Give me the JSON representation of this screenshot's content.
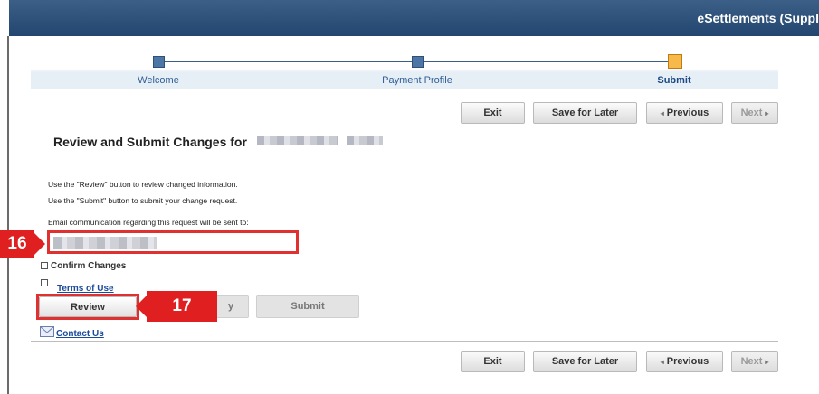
{
  "header": {
    "title": "eSettlements (Suppl"
  },
  "steps": [
    {
      "label": "Welcome",
      "active": false
    },
    {
      "label": "Payment Profile",
      "active": false
    },
    {
      "label": "Submit",
      "active": true
    }
  ],
  "nav": {
    "exit": "Exit",
    "save_for_later": "Save for Later",
    "previous": "Previous",
    "next": "Next"
  },
  "nav_glyphs": {
    "previous": "◂",
    "next": "▸"
  },
  "page": {
    "title": "Review and Submit Changes for",
    "line1": "Use the \"Review\" button to review changed information.",
    "line2": "Use the \"Submit\" button to submit your change request.",
    "email_label": "Email communication regarding this request will be sent to:",
    "email_value": ""
  },
  "checkboxes": {
    "confirm_changes": "Confirm Changes",
    "terms_of_use": "Terms of Use"
  },
  "actions": {
    "review": "Review",
    "partial": "y",
    "submit": "Submit"
  },
  "contact": {
    "label": "Contact Us"
  },
  "callouts": {
    "sixteen": "16",
    "seventeen": "17"
  },
  "colors": {
    "header": "#22466f",
    "callout": "#e02020",
    "link": "#1a4a9a"
  }
}
